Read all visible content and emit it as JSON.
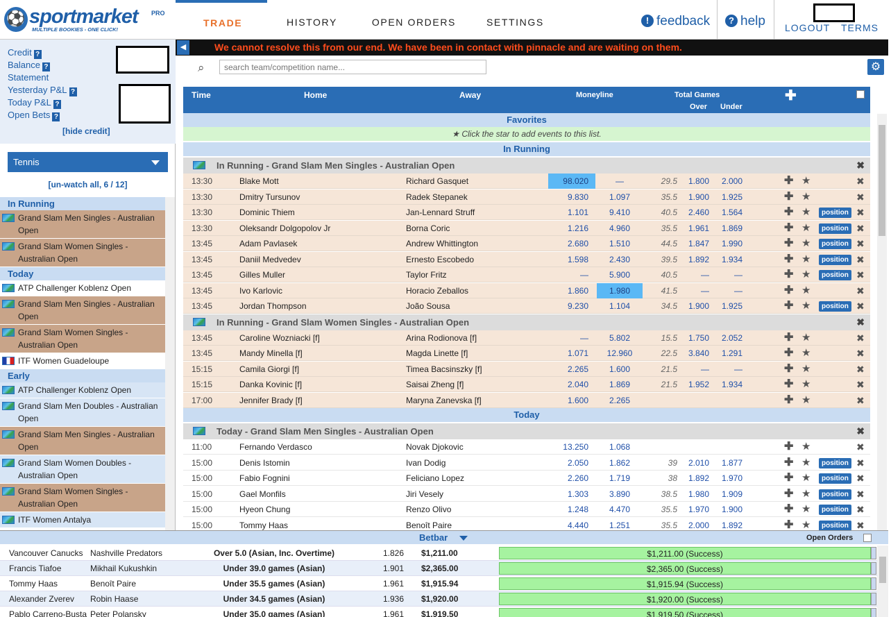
{
  "app": {
    "brand": "sportmarket",
    "brand_pro": "PRO",
    "tagline": "MULTIPLE BOOKIES - ONE CLICK!"
  },
  "nav": {
    "tabs": [
      "TRADE",
      "HISTORY",
      "OPEN ORDERS",
      "SETTINGS"
    ],
    "active": "TRADE",
    "feedback": "feedback",
    "help": "help",
    "logout": "LOGOUT",
    "terms": "TERMS"
  },
  "alert": {
    "message": "We cannot resolve this from our end. We have been in contact with pinnacle and are waiting on them."
  },
  "search": {
    "placeholder": "search team/competition name..."
  },
  "credit": {
    "items": [
      "Credit",
      "Balance",
      "Statement",
      "Yesterday P&L",
      "Today P&L",
      "Open Bets"
    ],
    "hide": "[hide credit]"
  },
  "sidebar": {
    "sport": "Tennis",
    "unwatch": "[un-watch all, 6 / 12]",
    "sections": [
      {
        "title": "In Running",
        "items": [
          {
            "name": "Grand Slam Men Singles - Australian Open",
            "style": "brown",
            "flag": "world"
          },
          {
            "name": "Grand Slam Women Singles - Australian Open",
            "style": "brown",
            "flag": "world"
          }
        ]
      },
      {
        "title": "Today",
        "items": [
          {
            "name": "ATP Challenger Koblenz Open",
            "style": "white",
            "flag": "world"
          },
          {
            "name": "Grand Slam Men Singles - Australian Open",
            "style": "brown",
            "flag": "world"
          },
          {
            "name": "Grand Slam Women Singles - Australian Open",
            "style": "brown",
            "flag": "world"
          },
          {
            "name": "ITF Women Guadeloupe",
            "style": "white",
            "flag": "fr"
          }
        ]
      },
      {
        "title": "Early",
        "items": [
          {
            "name": "ATP Challenger Koblenz Open",
            "style": "blue",
            "flag": "world"
          },
          {
            "name": "Grand Slam Men Doubles - Australian Open",
            "style": "blue",
            "flag": "world"
          },
          {
            "name": "Grand Slam Men Singles - Australian Open",
            "style": "brown",
            "flag": "world"
          },
          {
            "name": "Grand Slam Women Doubles - Australian Open",
            "style": "blue",
            "flag": "world"
          },
          {
            "name": "Grand Slam Women Singles - Australian Open",
            "style": "brown",
            "flag": "world"
          },
          {
            "name": "ITF Women Antalya",
            "style": "blue",
            "flag": "world"
          }
        ]
      }
    ]
  },
  "table": {
    "headers": {
      "time": "Time",
      "home": "Home",
      "away": "Away",
      "moneyline": "Moneyline",
      "total": "Total Games",
      "over": "Over",
      "under": "Under"
    },
    "favorites_title": "Favorites",
    "favorites_note": "Click the star to add events to this list.",
    "position_label": "position",
    "bands": [
      "In Running",
      "Today"
    ],
    "groups": [
      {
        "band": "In Running",
        "title": "In Running - Grand Slam Men Singles - Australian Open",
        "kind": "live",
        "rows": [
          {
            "t": "13:30",
            "h": "Blake Mott",
            "a": "Richard Gasquet",
            "m1": "98.020",
            "m2": "—",
            "l": "29.5",
            "o": "1.800",
            "u": "2.000",
            "pos": false,
            "hl": 1
          },
          {
            "t": "13:30",
            "h": "Dmitry Tursunov",
            "a": "Radek Stepanek",
            "m1": "9.830",
            "m2": "1.097",
            "l": "35.5",
            "o": "1.900",
            "u": "1.925",
            "pos": false,
            "hl": 0
          },
          {
            "t": "13:30",
            "h": "Dominic Thiem",
            "a": "Jan-Lennard Struff",
            "m1": "1.101",
            "m2": "9.410",
            "l": "40.5",
            "o": "2.460",
            "u": "1.564",
            "pos": true,
            "hl": 0
          },
          {
            "t": "13:30",
            "h": "Oleksandr Dolgopolov Jr",
            "a": "Borna Coric",
            "m1": "1.216",
            "m2": "4.960",
            "l": "35.5",
            "o": "1.961",
            "u": "1.869",
            "pos": true,
            "hl": 0
          },
          {
            "t": "13:45",
            "h": "Adam Pavlasek",
            "a": "Andrew Whittington",
            "m1": "2.680",
            "m2": "1.510",
            "l": "44.5",
            "o": "1.847",
            "u": "1.990",
            "pos": true,
            "hl": 0
          },
          {
            "t": "13:45",
            "h": "Daniil Medvedev",
            "a": "Ernesto Escobedo",
            "m1": "1.598",
            "m2": "2.430",
            "l": "39.5",
            "o": "1.892",
            "u": "1.934",
            "pos": true,
            "hl": 0
          },
          {
            "t": "13:45",
            "h": "Gilles Muller",
            "a": "Taylor Fritz",
            "m1": "—",
            "m2": "5.900",
            "l": "40.5",
            "o": "—",
            "u": "—",
            "pos": true,
            "hl": 0
          },
          {
            "t": "13:45",
            "h": "Ivo Karlovic",
            "a": "Horacio Zeballos",
            "m1": "1.860",
            "m2": "1.980",
            "l": "41.5",
            "o": "—",
            "u": "—",
            "pos": false,
            "hl": 2
          },
          {
            "t": "13:45",
            "h": "Jordan Thompson",
            "a": "João Sousa",
            "m1": "9.230",
            "m2": "1.104",
            "l": "34.5",
            "o": "1.900",
            "u": "1.925",
            "pos": true,
            "hl": 0
          }
        ]
      },
      {
        "band": "",
        "title": "In Running - Grand Slam Women Singles - Australian Open",
        "kind": "live",
        "rows": [
          {
            "t": "13:45",
            "h": "Caroline Wozniacki [f]",
            "a": "Arina Rodionova [f]",
            "m1": "—",
            "m2": "5.802",
            "l": "15.5",
            "o": "1.750",
            "u": "2.052",
            "pos": false,
            "hl": 0
          },
          {
            "t": "13:45",
            "h": "Mandy Minella [f]",
            "a": "Magda Linette [f]",
            "m1": "1.071",
            "m2": "12.960",
            "l": "22.5",
            "o": "3.840",
            "u": "1.291",
            "pos": false,
            "hl": 0
          },
          {
            "t": "15:15",
            "h": "Camila Giorgi [f]",
            "a": "Timea Bacsinszky [f]",
            "m1": "2.265",
            "m2": "1.600",
            "l": "21.5",
            "o": "—",
            "u": "—",
            "pos": false,
            "hl": 0
          },
          {
            "t": "15:15",
            "h": "Danka Kovinic [f]",
            "a": "Saisai Zheng [f]",
            "m1": "2.040",
            "m2": "1.869",
            "l": "21.5",
            "o": "1.952",
            "u": "1.934",
            "pos": false,
            "hl": 0
          },
          {
            "t": "17:00",
            "h": "Jennifer Brady [f]",
            "a": "Maryna Zanevska [f]",
            "m1": "1.600",
            "m2": "2.265",
            "l": "",
            "o": "",
            "u": "",
            "pos": false,
            "hl": 0
          }
        ]
      },
      {
        "band": "Today",
        "title": "Today - Grand Slam Men Singles - Australian Open",
        "kind": "today",
        "rows": [
          {
            "t": "11:00",
            "h": "Fernando Verdasco",
            "a": "Novak Djokovic",
            "m1": "13.250",
            "m2": "1.068",
            "l": "",
            "o": "",
            "u": "",
            "pos": false,
            "hl": 0
          },
          {
            "t": "15:00",
            "h": "Denis Istomin",
            "a": "Ivan Dodig",
            "m1": "2.050",
            "m2": "1.862",
            "l": "39",
            "o": "2.010",
            "u": "1.877",
            "pos": true,
            "hl": 0
          },
          {
            "t": "15:00",
            "h": "Fabio Fognini",
            "a": "Feliciano Lopez",
            "m1": "2.260",
            "m2": "1.719",
            "l": "38",
            "o": "1.892",
            "u": "1.970",
            "pos": true,
            "hl": 0
          },
          {
            "t": "15:00",
            "h": "Gael Monfils",
            "a": "Jiri Vesely",
            "m1": "1.303",
            "m2": "3.890",
            "l": "38.5",
            "o": "1.980",
            "u": "1.909",
            "pos": true,
            "hl": 0
          },
          {
            "t": "15:00",
            "h": "Hyeon Chung",
            "a": "Renzo Olivo",
            "m1": "1.248",
            "m2": "4.470",
            "l": "35.5",
            "o": "1.970",
            "u": "1.900",
            "pos": true,
            "hl": 0
          },
          {
            "t": "15:00",
            "h": "Tommy Haas",
            "a": "Benoît Paire",
            "m1": "4.440",
            "m2": "1.251",
            "l": "35.5",
            "o": "2.000",
            "u": "1.892",
            "pos": true,
            "hl": 0
          }
        ]
      }
    ]
  },
  "betbar": {
    "title": "Betbar",
    "open_orders": "Open Orders",
    "bets": [
      {
        "h": "Vancouver Canucks",
        "a": "Nashville Predators",
        "m": "Over 5.0 (Asian, Inc. Overtime)",
        "o": "1.826",
        "s": "$1,211.00",
        "st": "$1,211.00 (Success)"
      },
      {
        "h": "Francis Tiafoe",
        "a": "Mikhail Kukushkin",
        "m": "Under 39.0 games (Asian)",
        "o": "1.901",
        "s": "$2,365.00",
        "st": "$2,365.00 (Success)"
      },
      {
        "h": "Tommy Haas",
        "a": "Benoît Paire",
        "m": "Under 35.5 games (Asian)",
        "o": "1.961",
        "s": "$1,915.94",
        "st": "$1,915.94 (Success)"
      },
      {
        "h": "Alexander Zverev",
        "a": "Robin Haase",
        "m": "Under 34.5 games (Asian)",
        "o": "1.936",
        "s": "$1,920.00",
        "st": "$1,920.00 (Success)"
      },
      {
        "h": "Pablo Carreno-Busta",
        "a": "Peter Polansky",
        "m": "Under 35.0 games (Asian)",
        "o": "1.961",
        "s": "$1,919.50",
        "st": "$1,919.50 (Success)"
      }
    ]
  },
  "colors": {
    "accent": "#2a6db5",
    "alert": "#ff4c1c",
    "active_tab": "#e8702a",
    "success": "#a6f3a0"
  }
}
